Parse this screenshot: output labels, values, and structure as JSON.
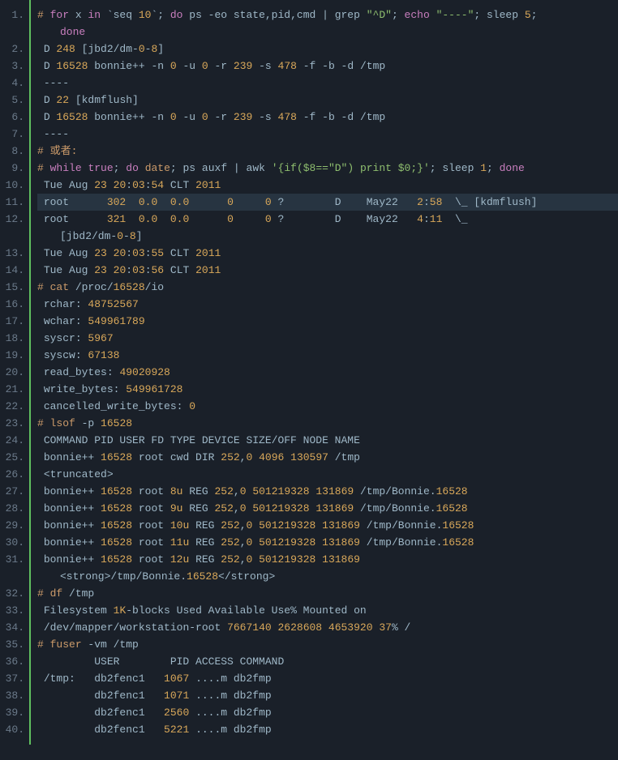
{
  "lines": [
    {
      "n": "1.",
      "segments": [
        [
          "c-hash",
          "# "
        ],
        [
          "c-key",
          "for"
        ],
        [
          "c-txt",
          " x "
        ],
        [
          "c-key",
          "in"
        ],
        [
          "c-txt",
          " `seq "
        ],
        [
          "c-num",
          "10"
        ],
        [
          "c-txt",
          "`; "
        ],
        [
          "c-key",
          "do"
        ],
        [
          "c-txt",
          " ps -eo state,pid,cmd | grep "
        ],
        [
          "c-str",
          "\"^D\""
        ],
        [
          "c-txt",
          "; "
        ],
        [
          "c-key",
          "echo"
        ],
        [
          "c-txt",
          " "
        ],
        [
          "c-str",
          "\"----\""
        ],
        [
          "c-txt",
          "; sleep "
        ],
        [
          "c-num",
          "5"
        ],
        [
          "c-txt",
          ";"
        ]
      ],
      "wrap": [
        [
          "c-key",
          "done"
        ]
      ]
    },
    {
      "n": "2.",
      "segments": [
        [
          "c-txt",
          " D "
        ],
        [
          "c-num",
          "248"
        ],
        [
          "c-txt",
          " [jbd2/dm-"
        ],
        [
          "c-num",
          "0"
        ],
        [
          "c-txt",
          "-"
        ],
        [
          "c-num",
          "8"
        ],
        [
          "c-txt",
          "]"
        ]
      ]
    },
    {
      "n": "3.",
      "segments": [
        [
          "c-txt",
          " D "
        ],
        [
          "c-num",
          "16528"
        ],
        [
          "c-txt",
          " bonnie++ -n "
        ],
        [
          "c-num",
          "0"
        ],
        [
          "c-txt",
          " -u "
        ],
        [
          "c-num",
          "0"
        ],
        [
          "c-txt",
          " -r "
        ],
        [
          "c-num",
          "239"
        ],
        [
          "c-txt",
          " -s "
        ],
        [
          "c-num",
          "478"
        ],
        [
          "c-txt",
          " -f -b -d /tmp"
        ]
      ]
    },
    {
      "n": "4.",
      "segments": [
        [
          "c-txt",
          " ----"
        ]
      ]
    },
    {
      "n": "5.",
      "segments": [
        [
          "c-txt",
          " D "
        ],
        [
          "c-num",
          "22"
        ],
        [
          "c-txt",
          " [kdmflush]"
        ]
      ]
    },
    {
      "n": "6.",
      "segments": [
        [
          "c-txt",
          " D "
        ],
        [
          "c-num",
          "16528"
        ],
        [
          "c-txt",
          " bonnie++ -n "
        ],
        [
          "c-num",
          "0"
        ],
        [
          "c-txt",
          " -u "
        ],
        [
          "c-num",
          "0"
        ],
        [
          "c-txt",
          " -r "
        ],
        [
          "c-num",
          "239"
        ],
        [
          "c-txt",
          " -s "
        ],
        [
          "c-num",
          "478"
        ],
        [
          "c-txt",
          " -f -b -d /tmp"
        ]
      ]
    },
    {
      "n": "7.",
      "segments": [
        [
          "c-txt",
          " ----"
        ]
      ]
    },
    {
      "n": "8.",
      "segments": [
        [
          "c-hash",
          "# 或者:"
        ]
      ]
    },
    {
      "n": "9.",
      "segments": [
        [
          "c-hash",
          "# "
        ],
        [
          "c-key",
          "while"
        ],
        [
          "c-txt",
          " "
        ],
        [
          "c-key",
          "true"
        ],
        [
          "c-txt",
          "; "
        ],
        [
          "c-key",
          "do"
        ],
        [
          "c-txt",
          " "
        ],
        [
          "c-cmd",
          "date"
        ],
        [
          "c-txt",
          "; ps auxf | awk "
        ],
        [
          "c-str",
          "'{if($8==\"D\") print $0;}'"
        ],
        [
          "c-txt",
          "; sleep "
        ],
        [
          "c-num",
          "1"
        ],
        [
          "c-txt",
          "; "
        ],
        [
          "c-key",
          "done"
        ]
      ]
    },
    {
      "n": "10.",
      "segments": [
        [
          "c-txt",
          " Tue Aug "
        ],
        [
          "c-num",
          "23"
        ],
        [
          "c-txt",
          " "
        ],
        [
          "c-num",
          "20"
        ],
        [
          "c-txt",
          ":"
        ],
        [
          "c-num",
          "03"
        ],
        [
          "c-txt",
          ":"
        ],
        [
          "c-num",
          "54"
        ],
        [
          "c-txt",
          " CLT "
        ],
        [
          "c-num",
          "2011"
        ]
      ]
    },
    {
      "n": "11.",
      "hl": true,
      "segments": [
        [
          "c-txt",
          " root      "
        ],
        [
          "c-num",
          "302"
        ],
        [
          "c-txt",
          "  "
        ],
        [
          "c-num",
          "0.0"
        ],
        [
          "c-txt",
          "  "
        ],
        [
          "c-num",
          "0.0"
        ],
        [
          "c-txt",
          "      "
        ],
        [
          "c-num",
          "0"
        ],
        [
          "c-txt",
          "     "
        ],
        [
          "c-num",
          "0"
        ],
        [
          "c-txt",
          " ?        D    May22   "
        ],
        [
          "c-num",
          "2"
        ],
        [
          "c-txt",
          ":"
        ],
        [
          "c-num",
          "58"
        ],
        [
          "c-txt",
          "  \\_ [kdmflush]"
        ]
      ]
    },
    {
      "n": "12.",
      "segments": [
        [
          "c-txt",
          " root      "
        ],
        [
          "c-num",
          "321"
        ],
        [
          "c-txt",
          "  "
        ],
        [
          "c-num",
          "0.0"
        ],
        [
          "c-txt",
          "  "
        ],
        [
          "c-num",
          "0.0"
        ],
        [
          "c-txt",
          "      "
        ],
        [
          "c-num",
          "0"
        ],
        [
          "c-txt",
          "     "
        ],
        [
          "c-num",
          "0"
        ],
        [
          "c-txt",
          " ?        D    May22   "
        ],
        [
          "c-num",
          "4"
        ],
        [
          "c-txt",
          ":"
        ],
        [
          "c-num",
          "11"
        ],
        [
          "c-txt",
          "  \\_"
        ]
      ],
      "wrap": [
        [
          "c-txt",
          "[jbd2/dm-"
        ],
        [
          "c-num",
          "0"
        ],
        [
          "c-txt",
          "-"
        ],
        [
          "c-num",
          "8"
        ],
        [
          "c-txt",
          "]"
        ]
      ]
    },
    {
      "n": "13.",
      "segments": [
        [
          "c-txt",
          " Tue Aug "
        ],
        [
          "c-num",
          "23"
        ],
        [
          "c-txt",
          " "
        ],
        [
          "c-num",
          "20"
        ],
        [
          "c-txt",
          ":"
        ],
        [
          "c-num",
          "03"
        ],
        [
          "c-txt",
          ":"
        ],
        [
          "c-num",
          "55"
        ],
        [
          "c-txt",
          " CLT "
        ],
        [
          "c-num",
          "2011"
        ]
      ]
    },
    {
      "n": "14.",
      "segments": [
        [
          "c-txt",
          " Tue Aug "
        ],
        [
          "c-num",
          "23"
        ],
        [
          "c-txt",
          " "
        ],
        [
          "c-num",
          "20"
        ],
        [
          "c-txt",
          ":"
        ],
        [
          "c-num",
          "03"
        ],
        [
          "c-txt",
          ":"
        ],
        [
          "c-num",
          "56"
        ],
        [
          "c-txt",
          " CLT "
        ],
        [
          "c-num",
          "2011"
        ]
      ]
    },
    {
      "n": "15.",
      "segments": [
        [
          "c-hash",
          "# "
        ],
        [
          "c-cmd",
          "cat"
        ],
        [
          "c-txt",
          " /proc/"
        ],
        [
          "c-num",
          "16528"
        ],
        [
          "c-txt",
          "/io"
        ]
      ]
    },
    {
      "n": "16.",
      "segments": [
        [
          "c-label",
          " rchar: "
        ],
        [
          "c-num",
          "48752567"
        ]
      ]
    },
    {
      "n": "17.",
      "segments": [
        [
          "c-label",
          " wchar: "
        ],
        [
          "c-num",
          "549961789"
        ]
      ]
    },
    {
      "n": "18.",
      "segments": [
        [
          "c-label",
          " syscr: "
        ],
        [
          "c-num",
          "5967"
        ]
      ]
    },
    {
      "n": "19.",
      "segments": [
        [
          "c-label",
          " syscw: "
        ],
        [
          "c-num",
          "67138"
        ]
      ]
    },
    {
      "n": "20.",
      "segments": [
        [
          "c-label",
          " read_bytes: "
        ],
        [
          "c-num",
          "49020928"
        ]
      ]
    },
    {
      "n": "21.",
      "segments": [
        [
          "c-label",
          " write_bytes: "
        ],
        [
          "c-num",
          "549961728"
        ]
      ]
    },
    {
      "n": "22.",
      "segments": [
        [
          "c-label",
          " cancelled_write_bytes: "
        ],
        [
          "c-num",
          "0"
        ]
      ]
    },
    {
      "n": "23.",
      "segments": [
        [
          "c-hash",
          "# "
        ],
        [
          "c-cmd",
          "lsof"
        ],
        [
          "c-txt",
          " -p "
        ],
        [
          "c-num",
          "16528"
        ]
      ]
    },
    {
      "n": "24.",
      "segments": [
        [
          "c-txt",
          " COMMAND PID USER FD TYPE DEVICE SIZE/OFF NODE NAME"
        ]
      ]
    },
    {
      "n": "25.",
      "segments": [
        [
          "c-txt",
          " bonnie++ "
        ],
        [
          "c-num",
          "16528"
        ],
        [
          "c-txt",
          " root cwd DIR "
        ],
        [
          "c-num",
          "252"
        ],
        [
          "c-txt",
          ","
        ],
        [
          "c-num",
          "0"
        ],
        [
          "c-txt",
          " "
        ],
        [
          "c-num",
          "4096"
        ],
        [
          "c-txt",
          " "
        ],
        [
          "c-num",
          "130597"
        ],
        [
          "c-txt",
          " /tmp"
        ]
      ]
    },
    {
      "n": "26.",
      "segments": [
        [
          "c-txt",
          " <truncated>"
        ]
      ]
    },
    {
      "n": "27.",
      "segments": [
        [
          "c-txt",
          " bonnie++ "
        ],
        [
          "c-num",
          "16528"
        ],
        [
          "c-txt",
          " root "
        ],
        [
          "c-num",
          "8u"
        ],
        [
          "c-txt",
          " REG "
        ],
        [
          "c-num",
          "252"
        ],
        [
          "c-txt",
          ","
        ],
        [
          "c-num",
          "0"
        ],
        [
          "c-txt",
          " "
        ],
        [
          "c-num",
          "501219328"
        ],
        [
          "c-txt",
          " "
        ],
        [
          "c-num",
          "131869"
        ],
        [
          "c-txt",
          " /tmp/Bonnie."
        ],
        [
          "c-num",
          "16528"
        ]
      ]
    },
    {
      "n": "28.",
      "segments": [
        [
          "c-txt",
          " bonnie++ "
        ],
        [
          "c-num",
          "16528"
        ],
        [
          "c-txt",
          " root "
        ],
        [
          "c-num",
          "9u"
        ],
        [
          "c-txt",
          " REG "
        ],
        [
          "c-num",
          "252"
        ],
        [
          "c-txt",
          ","
        ],
        [
          "c-num",
          "0"
        ],
        [
          "c-txt",
          " "
        ],
        [
          "c-num",
          "501219328"
        ],
        [
          "c-txt",
          " "
        ],
        [
          "c-num",
          "131869"
        ],
        [
          "c-txt",
          " /tmp/Bonnie."
        ],
        [
          "c-num",
          "16528"
        ]
      ]
    },
    {
      "n": "29.",
      "segments": [
        [
          "c-txt",
          " bonnie++ "
        ],
        [
          "c-num",
          "16528"
        ],
        [
          "c-txt",
          " root "
        ],
        [
          "c-num",
          "10u"
        ],
        [
          "c-txt",
          " REG "
        ],
        [
          "c-num",
          "252"
        ],
        [
          "c-txt",
          ","
        ],
        [
          "c-num",
          "0"
        ],
        [
          "c-txt",
          " "
        ],
        [
          "c-num",
          "501219328"
        ],
        [
          "c-txt",
          " "
        ],
        [
          "c-num",
          "131869"
        ],
        [
          "c-txt",
          " /tmp/Bonnie."
        ],
        [
          "c-num",
          "16528"
        ]
      ]
    },
    {
      "n": "30.",
      "segments": [
        [
          "c-txt",
          " bonnie++ "
        ],
        [
          "c-num",
          "16528"
        ],
        [
          "c-txt",
          " root "
        ],
        [
          "c-num",
          "11u"
        ],
        [
          "c-txt",
          " REG "
        ],
        [
          "c-num",
          "252"
        ],
        [
          "c-txt",
          ","
        ],
        [
          "c-num",
          "0"
        ],
        [
          "c-txt",
          " "
        ],
        [
          "c-num",
          "501219328"
        ],
        [
          "c-txt",
          " "
        ],
        [
          "c-num",
          "131869"
        ],
        [
          "c-txt",
          " /tmp/Bonnie."
        ],
        [
          "c-num",
          "16528"
        ]
      ]
    },
    {
      "n": "31.",
      "segments": [
        [
          "c-txt",
          " bonnie++ "
        ],
        [
          "c-num",
          "16528"
        ],
        [
          "c-txt",
          " root "
        ],
        [
          "c-num",
          "12u"
        ],
        [
          "c-txt",
          " REG "
        ],
        [
          "c-num",
          "252"
        ],
        [
          "c-txt",
          ","
        ],
        [
          "c-num",
          "0"
        ],
        [
          "c-txt",
          " "
        ],
        [
          "c-num",
          "501219328"
        ],
        [
          "c-txt",
          " "
        ],
        [
          "c-num",
          "131869"
        ]
      ],
      "wrap": [
        [
          "c-txt",
          "<strong>/tmp/Bonnie."
        ],
        [
          "c-num",
          "16528"
        ],
        [
          "c-txt",
          "</strong>"
        ]
      ]
    },
    {
      "n": "32.",
      "segments": [
        [
          "c-hash",
          "# "
        ],
        [
          "c-cmd",
          "df"
        ],
        [
          "c-txt",
          " /tmp"
        ]
      ]
    },
    {
      "n": "33.",
      "segments": [
        [
          "c-txt",
          " Filesystem "
        ],
        [
          "c-num",
          "1K"
        ],
        [
          "c-txt",
          "-blocks Used Available Use% Mounted on"
        ]
      ]
    },
    {
      "n": "34.",
      "segments": [
        [
          "c-txt",
          " /dev/mapper/workstation-root "
        ],
        [
          "c-num",
          "7667140"
        ],
        [
          "c-txt",
          " "
        ],
        [
          "c-num",
          "2628608"
        ],
        [
          "c-txt",
          " "
        ],
        [
          "c-num",
          "4653920"
        ],
        [
          "c-txt",
          " "
        ],
        [
          "c-num",
          "37"
        ],
        [
          "c-txt",
          "% /"
        ]
      ]
    },
    {
      "n": "35.",
      "segments": [
        [
          "c-hash",
          "# "
        ],
        [
          "c-cmd",
          "fuser"
        ],
        [
          "c-txt",
          " -vm /tmp"
        ]
      ]
    },
    {
      "n": "36.",
      "segments": [
        [
          "c-txt",
          "         USER        PID ACCESS COMMAND"
        ]
      ]
    },
    {
      "n": "37.",
      "segments": [
        [
          "c-txt",
          " /tmp:   db2fenc1   "
        ],
        [
          "c-num",
          "1067"
        ],
        [
          "c-txt",
          " ....m db2fmp"
        ]
      ]
    },
    {
      "n": "38.",
      "segments": [
        [
          "c-txt",
          "         db2fenc1   "
        ],
        [
          "c-num",
          "1071"
        ],
        [
          "c-txt",
          " ....m db2fmp"
        ]
      ]
    },
    {
      "n": "39.",
      "segments": [
        [
          "c-txt",
          "         db2fenc1   "
        ],
        [
          "c-num",
          "2560"
        ],
        [
          "c-txt",
          " ....m db2fmp"
        ]
      ]
    },
    {
      "n": "40.",
      "segments": [
        [
          "c-txt",
          "         db2fenc1   "
        ],
        [
          "c-num",
          "5221"
        ],
        [
          "c-txt",
          " ....m db2fmp"
        ]
      ]
    }
  ]
}
